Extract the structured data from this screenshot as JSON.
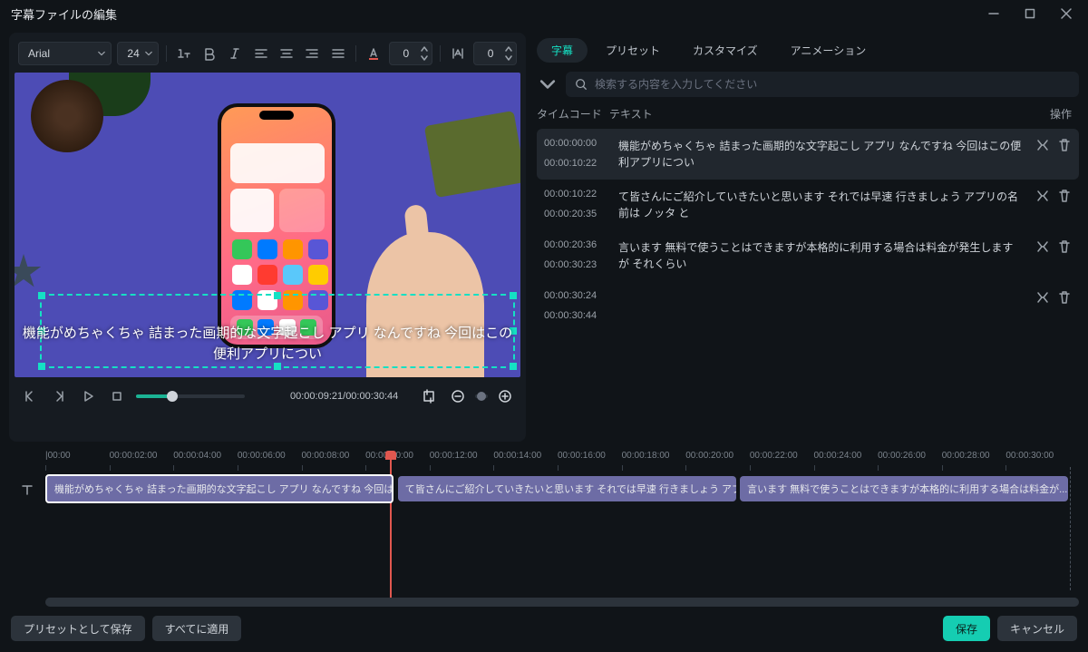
{
  "window": {
    "title": "字幕ファイルの編集"
  },
  "toolbar": {
    "font_family": "Arial",
    "font_size": "24",
    "text_color_value": "0",
    "outline_value": "0"
  },
  "preview": {
    "subtitle_text": "機能がめちゃくちゃ 詰まった画期的な文字起こし アプリ なんですね 今回はこの便利アプリについ"
  },
  "transport": {
    "current": "00:00:09:21",
    "total": "00:00:30:44"
  },
  "tabs": {
    "subtitle": "字幕",
    "preset": "プリセット",
    "customize": "カスタマイズ",
    "animation": "アニメーション"
  },
  "search": {
    "placeholder": "検索する内容を入力してください"
  },
  "columns": {
    "timecode": "タイムコード",
    "text": "テキスト",
    "ops": "操作"
  },
  "subtitles": [
    {
      "start": "00:00:00:00",
      "end": "00:00:10:22",
      "text": "機能がめちゃくちゃ 詰まった画期的な文字起こし アプリ なんですね 今回はこの便利アプリについ"
    },
    {
      "start": "00:00:10:22",
      "end": "00:00:20:35",
      "text": "て皆さんにご紹介していきたいと思います それでは早速 行きましょう アプリの名前は ノッタ と"
    },
    {
      "start": "00:00:20:36",
      "end": "00:00:30:23",
      "text": "言います 無料で使うことはできますが本格的に利用する場合は料金が発生しますが それくらい"
    },
    {
      "start": "00:00:30:24",
      "end": "00:00:30:44",
      "text": ""
    }
  ],
  "timeline": {
    "ticks": [
      "|00:00",
      "00:00:02:00",
      "00:00:04:00",
      "00:00:06:00",
      "00:00:08:00",
      "00:00:10:00",
      "00:00:12:00",
      "00:00:14:00",
      "00:00:16:00",
      "00:00:18:00",
      "00:00:20:00",
      "00:00:22:00",
      "00:00:24:00",
      "00:00:26:00",
      "00:00:28:00",
      "00:00:30:00"
    ],
    "clips": [
      {
        "text": "機能がめちゃくちゃ 詰まった画期的な文字起こし アプリ なんですね 今回はこ...",
        "selected": true,
        "left_pct": 0,
        "width_pct": 34
      },
      {
        "text": "て皆さんにご紹介していきたいと思います それでは早速 行きましょう アプリの...",
        "selected": false,
        "left_pct": 34.4,
        "width_pct": 33
      },
      {
        "text": "言います 無料で使うことはできますが本格的に利用する場合は料金が...",
        "selected": false,
        "left_pct": 67.8,
        "width_pct": 32
      }
    ]
  },
  "footer": {
    "save_preset": "プリセットとして保存",
    "apply_all": "すべてに適用",
    "save": "保存",
    "cancel": "キャンセル"
  }
}
